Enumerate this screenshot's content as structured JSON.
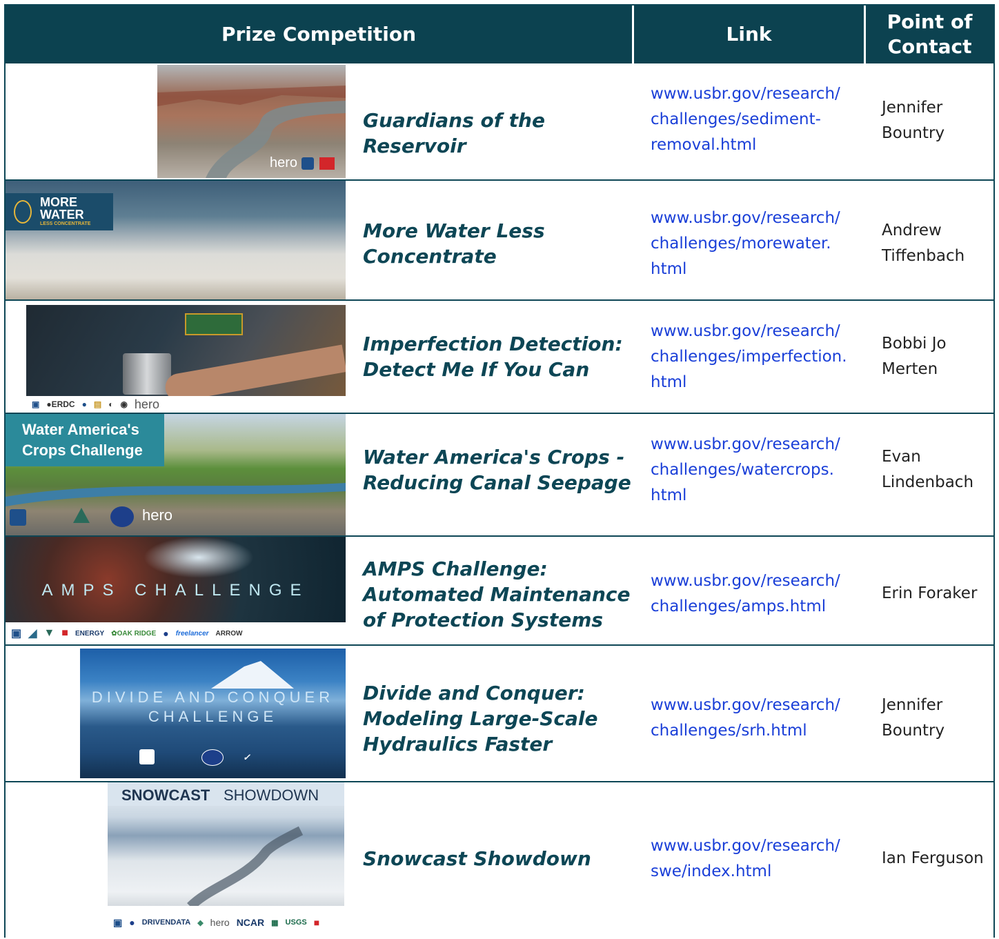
{
  "header": {
    "competition": "Prize Competition",
    "link": "Link",
    "point_of_contact": "Point of Contact"
  },
  "rows": [
    {
      "title": "Guardians of the Reservoir",
      "link": "www.usbr.gov/research/challenges/sediment-removal.html",
      "contact": "Jennifer Bountry",
      "image_text": "hero"
    },
    {
      "title": "More Water Less Concentrate",
      "link": "www.usbr.gov/research/challenges/morewater.html",
      "contact": "Andrew Tiffenbach",
      "image_text_1": "MORE",
      "image_text_2": "WATER",
      "image_text_3": "LESS CONCENTRATE"
    },
    {
      "title": "Imperfection Detection: Detect Me If You Can",
      "link": "www.usbr.gov/research/challenges/imperfection.html",
      "contact": "Bobbi Jo Merten",
      "image_text": "hero"
    },
    {
      "title": "Water America's Crops - Reducing Canal Seepage",
      "link": "www.usbr.gov/research/challenges/watercrops.html",
      "contact": "Evan Lindenbach",
      "image_text": "Water America's Crops Challenge",
      "image_logo": "hero"
    },
    {
      "title": "AMPS Challenge: Automated Maintenance of Protection Systems",
      "link": "www.usbr.gov/research/challenges/amps.html",
      "contact": "Erin Foraker",
      "image_text": "AMPS CHALLENGE"
    },
    {
      "title": "Divide and Conquer: Modeling Large-Scale Hydraulics Faster",
      "link": "www.usbr.gov/research/challenges/srh.html",
      "contact": "Jennifer Bountry",
      "image_text_1": "DIVIDE AND CONQUER",
      "image_text_2": "CHALLENGE"
    },
    {
      "title": "Snowcast Showdown",
      "link": "www.usbr.gov/research/swe/index.html",
      "contact": "Ian Ferguson",
      "image_text_1": "SNOWCAST",
      "image_text_2": "SHOWDOWN",
      "image_logo_1": "DRIVENDATA",
      "image_logo_2": "hero",
      "image_logo_3": "NCAR",
      "image_logo_4": "USGS"
    }
  ],
  "colors": {
    "header_bg": "#0c4250",
    "title": "#0d4655",
    "link": "#1a3fd8"
  }
}
